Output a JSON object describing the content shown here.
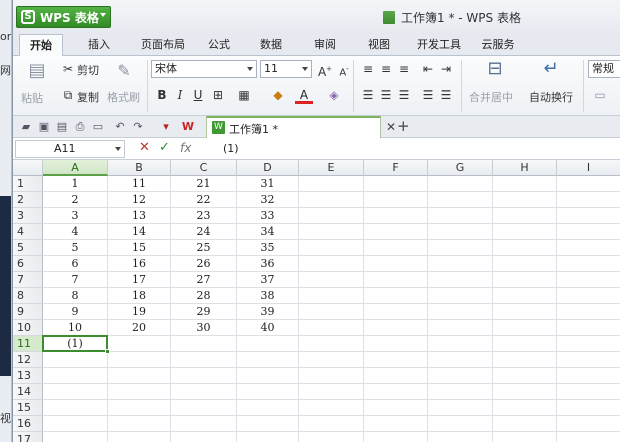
{
  "background_app": {
    "fragments": [
      "om",
      "网",
      "视图"
    ]
  },
  "app": {
    "button_label": "WPS 表格",
    "logo_letter": "S",
    "window_title": "工作簿1 * - WPS 表格"
  },
  "menu_tabs": [
    "开始",
    "插入",
    "页面布局",
    "公式",
    "数据",
    "审阅",
    "视图",
    "开发工具",
    "云服务"
  ],
  "active_tab": "开始",
  "ribbon": {
    "paste": "粘贴",
    "cut": "剪切",
    "copy": "复制",
    "format_painter": "格式刷",
    "font_name": "宋体",
    "font_size": "11",
    "bold": "B",
    "italic": "I",
    "underline": "U",
    "merge_center": "合并居中",
    "wrap_text": "自动换行",
    "number_format": "常规"
  },
  "document_tab": {
    "name": "工作簿1 *",
    "wps_glyph": "W"
  },
  "formula_bar": {
    "name_box": "A11",
    "cancel": "✕",
    "confirm": "✓",
    "fx": "fx",
    "value": "(1)"
  },
  "columns": [
    "A",
    "B",
    "C",
    "D",
    "E",
    "F",
    "G",
    "H",
    "I"
  ],
  "selected_column": "A",
  "rows": [
    [
      "1",
      "11",
      "21",
      "31"
    ],
    [
      "2",
      "12",
      "22",
      "32"
    ],
    [
      "3",
      "13",
      "23",
      "33"
    ],
    [
      "4",
      "14",
      "24",
      "34"
    ],
    [
      "5",
      "15",
      "25",
      "35"
    ],
    [
      "6",
      "16",
      "26",
      "36"
    ],
    [
      "7",
      "17",
      "27",
      "37"
    ],
    [
      "8",
      "18",
      "28",
      "38"
    ],
    [
      "9",
      "19",
      "29",
      "39"
    ],
    [
      "10",
      "20",
      "30",
      "40"
    ],
    [
      "(1)",
      "",
      "",
      ""
    ],
    [
      "",
      "",
      "",
      ""
    ],
    [
      "",
      "",
      "",
      ""
    ],
    [
      "",
      "",
      "",
      ""
    ],
    [
      "",
      "",
      "",
      ""
    ],
    [
      "",
      "",
      "",
      ""
    ],
    [
      "",
      "",
      "",
      ""
    ]
  ],
  "active_row": 11,
  "colors": {
    "accent_green": "#3f8c2e",
    "header_selected": "#d5e9cc",
    "app_button": "#3d9a30"
  }
}
